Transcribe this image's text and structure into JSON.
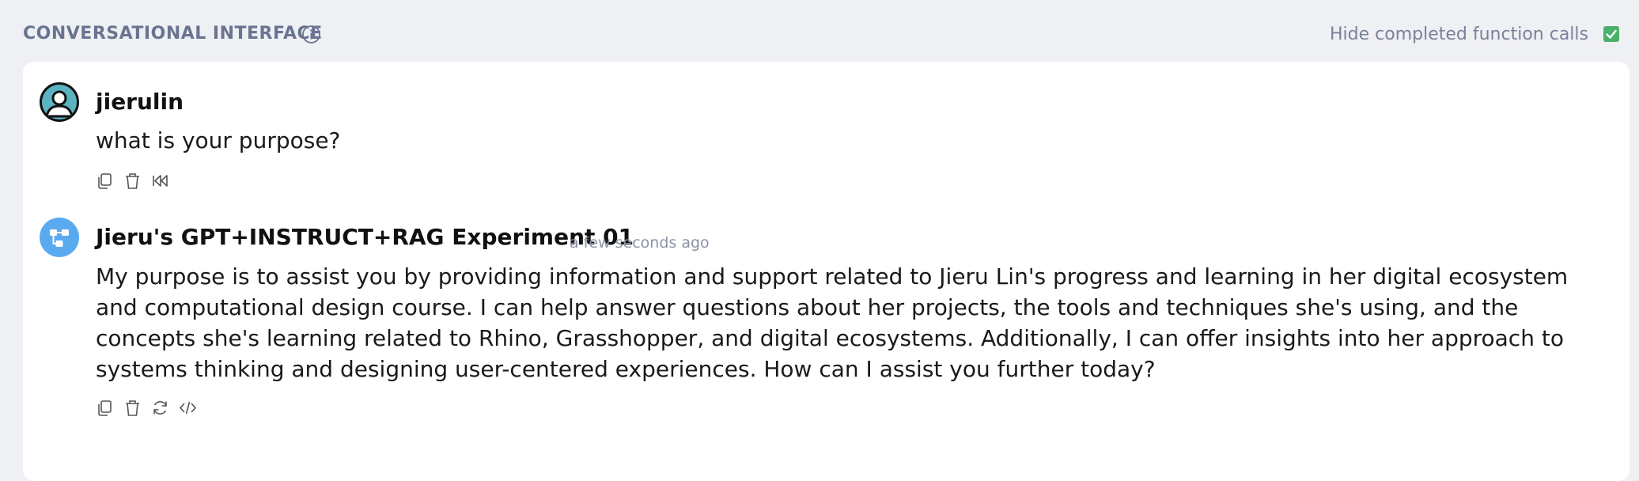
{
  "header": {
    "title": "CONVERSATIONAL INTERFACE",
    "toggle_label": "Hide completed function calls",
    "toggle_checked": true,
    "checkbox_color": "#4caf6a"
  },
  "messages": [
    {
      "sender": "jierulin",
      "text": "what is your purpose?",
      "avatar": "user-avatar",
      "actions": [
        "copy-icon",
        "trash-icon",
        "rewind-icon"
      ]
    },
    {
      "sender": "Jieru's GPT+INSTRUCT+RAG Experiment 01",
      "timestamp": "a few seconds ago",
      "text": "My purpose is to assist you by providing information and support related to Jieru Lin's progress and learning in her digital ecosystem and computational design course. I can help answer questions about her projects, the tools and techniques she's using, and the concepts she's learning related to Rhino, Grasshopper, and digital ecosystems. Additionally, I can offer insights into her approach to systems thinking and designing user-centered experiences. How can I assist you further today?",
      "avatar": "bot-avatar",
      "actions": [
        "copy-icon",
        "trash-icon",
        "refresh-icon",
        "code-icon"
      ]
    }
  ]
}
